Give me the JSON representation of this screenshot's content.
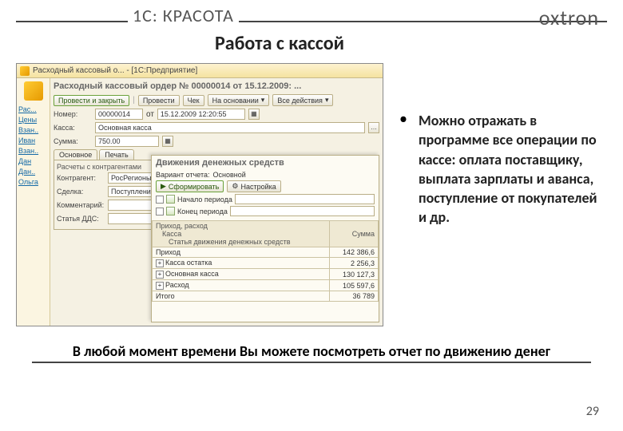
{
  "slide": {
    "main_title": "1С: КРАСОТА",
    "subtitle": "Работа с кассой",
    "logo": "oxtron",
    "bullet": "Можно отражать в программе все операции по кассе: оплата поставщику, выплата зарплаты и аванса, поступление от покупателей и др.",
    "bottom": "В любой момент времени Вы можете посмотреть отчет по движению денег",
    "page": "29"
  },
  "window": {
    "titlebar": "Расходный кассовый о... - [1С:Предприятие]",
    "sidebar": [
      "Рас...",
      "Цены",
      "Взан..",
      "Иван",
      "Взан..",
      "Дан",
      "Дан..",
      "Ольга"
    ],
    "doc_title": "Расходный кассовый ордер № 00000014 от 15.12.2009: ...",
    "toolbar": {
      "post_close": "Провести и закрыть",
      "post": "Провести",
      "check": "Чек",
      "based": "На основании",
      "all": "Все действия"
    },
    "fields": {
      "number_lbl": "Номер:",
      "number": "00000014",
      "date": "15.12.2009 12:20:55",
      "kassa_lbl": "Касса:",
      "kassa": "Основная касса",
      "sum_lbl": "Сумма:",
      "sum": "750.00"
    },
    "tabs": [
      "Основное",
      "Печать"
    ],
    "pane": {
      "title": "Расчеты с контрагентами",
      "contr_lbl": "Контрагент:",
      "contr": "РосРегионы",
      "deal_lbl": "Сделка:",
      "deal": "Поступление...",
      "comm_lbl": "Комментарий:",
      "cost_lbl": "Статья ДДС:"
    }
  },
  "report": {
    "title": "Движения денежных средств",
    "variant_lbl": "Вариант отчета:",
    "variant": "Основной",
    "form_btn": "Сформировать",
    "settings_btn": "Настройка",
    "filt1": "Начало периода",
    "filt2": "Конец периода",
    "col1": "Приход, расход",
    "col2": "Касса",
    "col3": "Статья движения денежных средств",
    "col_sum": "Сумма",
    "rows": [
      {
        "label": "Приход",
        "val": "142 386,6",
        "exp": null
      },
      {
        "label": "Касса остатка",
        "val": "2 256,3",
        "exp": "+"
      },
      {
        "label": "Основная касса",
        "val": "130 127,3",
        "exp": "+"
      },
      {
        "label": "Расход",
        "val": "105 597,6",
        "exp": "+"
      },
      {
        "label": "Итого",
        "val": "36 789",
        "exp": null
      }
    ]
  }
}
